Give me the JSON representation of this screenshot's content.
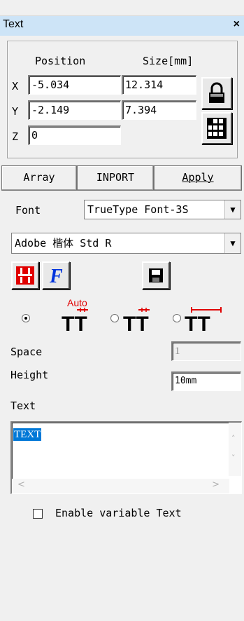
{
  "panel": {
    "title": "Text",
    "close": "×"
  },
  "position_group": {
    "header_position": "Position",
    "header_size": "Size[mm]",
    "rows": [
      {
        "axis": "X",
        "position": "-5.034",
        "size": "12.314"
      },
      {
        "axis": "Y",
        "position": "-2.149",
        "size": "7.394"
      },
      {
        "axis": "Z",
        "position": "0"
      }
    ]
  },
  "buttons": {
    "array": "Array",
    "import": "INPORT",
    "apply": "Apply"
  },
  "font": {
    "label": "Font",
    "type_value": "TrueType Font-3S",
    "name_value": "Adobe 楷体 Std R"
  },
  "spacing_modes": {
    "auto_label": "Auto",
    "selected": 0
  },
  "space": {
    "label": "Space",
    "value": "1"
  },
  "height": {
    "label": "Height",
    "value": "10mm"
  },
  "text": {
    "label": "Text",
    "value": "TEXT"
  },
  "variable_text": {
    "label": "Enable variable Text",
    "checked": false
  }
}
